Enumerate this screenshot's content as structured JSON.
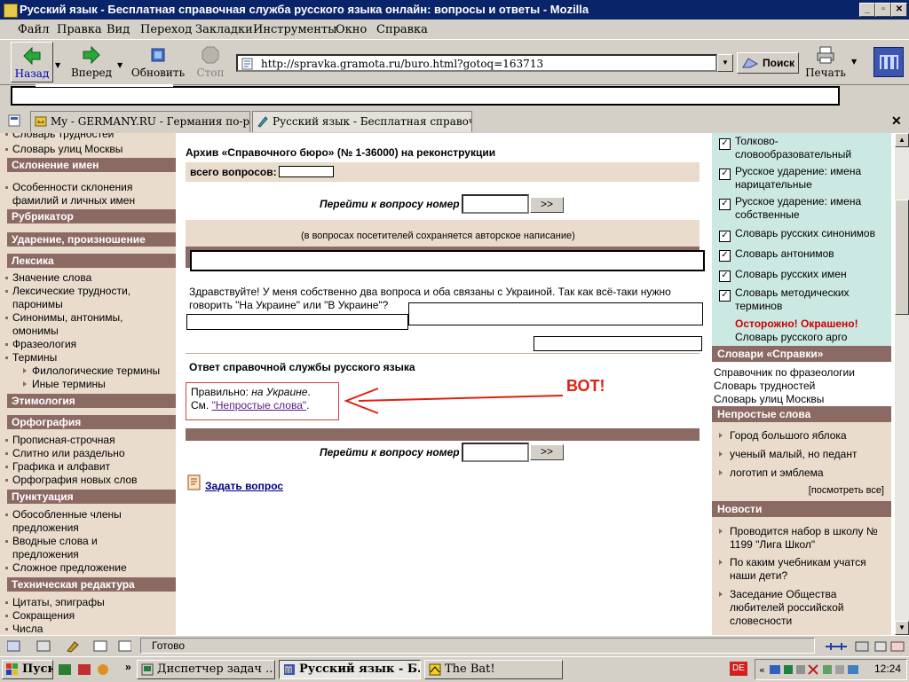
{
  "window": {
    "title": "Русский язык - Бесплатная справочная служба русского языка онлайн: вопросы и ответы - Mozilla",
    "buttons": [
      "_",
      "▫",
      "✕"
    ]
  },
  "menu": [
    "Файл",
    "Правка",
    "Вид",
    "Переход",
    "Закладки",
    "Инструменты",
    "Окно",
    "Справка"
  ],
  "nav": {
    "back": "Назад",
    "forward": "Вперед",
    "reload": "Обновить",
    "stop": "Стоп",
    "url": "http://spravka.gramota.ru/buro.html?gotoq=163713",
    "search": "Поиск",
    "print": "Печать"
  },
  "tabs": [
    {
      "label": "My - GERMANY.RU - Германия по-р...",
      "active": false
    },
    {
      "label": "Русский язык - Бесплатная справочн...",
      "active": true
    }
  ],
  "left_sidebar": {
    "items_top": [
      "Словарь трудностей",
      "Словарь улиц Москвы"
    ],
    "sections": [
      {
        "heading": "Склонение имен",
        "items": [
          "Особенности склонения фамилий и личных имен"
        ]
      },
      {
        "heading": "Рубрикатор",
        "items": []
      },
      {
        "heading": "Ударение, произношение",
        "items": []
      },
      {
        "heading": "Лексика",
        "items": [
          "Значение слова",
          "Лексические трудности, паронимы",
          "Синонимы, антонимы, омонимы",
          "Фразеология",
          "Термины"
        ],
        "subitems": [
          "Филологические термины",
          "Иные термины"
        ]
      },
      {
        "heading": "Этимология",
        "items": []
      },
      {
        "heading": "Орфография",
        "items": [
          "Прописная-строчная",
          "Слитно или раздельно",
          "Графика и алфавит",
          "Орфография новых слов"
        ]
      },
      {
        "heading": "Пунктуация",
        "items": [
          "Обособленные члены предложения",
          "Вводные слова и предложения",
          "Сложное предложение"
        ]
      },
      {
        "heading": "Техническая редактура",
        "items": [
          "Цитаты, эпиграфы",
          "Сокращения",
          "Числа"
        ]
      }
    ]
  },
  "main": {
    "archive_title": "Архив «Справочного бюро» (№ 1-36000) на реконструкции",
    "total_label": "всего вопросов:",
    "goto_label": "Перейти к вопросу номер",
    "go_button": ">>",
    "note": "(в вопросах посетителей сохраняется авторское написание)",
    "question": "Здравствуйте! У меня собственно два вопроса и оба связаны с Украиной. Так как всё-таки нужно говорить \"На Украине\" или \"В Украине\"?",
    "answer_heading": "Ответ справочной службы русского языка",
    "answer_prefix": "Правильно: ",
    "answer_value": "на Украине",
    "answer_suffix": ".",
    "see_prefix": "См. ",
    "see_link": "\"Непростые слова\"",
    "see_suffix": ".",
    "annotation": "ВОТ!",
    "ask_link": "Задать вопрос"
  },
  "right_sidebar": {
    "checked_dicts": [
      "Толково-словообразовательный",
      "Русское ударение: имена нарицательные",
      "Русское ударение: имена собственные",
      "Словарь русских синонимов",
      "Словарь антонимов",
      "Словарь русских имен",
      "Словарь методических терминов"
    ],
    "warning": "Осторожно! Окрашено!",
    "argo": "Словарь русского арго",
    "dicts_heading": "Словари «Справки»",
    "dicts_links": [
      "Справочник по фразеологии",
      "Словарь трудностей",
      "Словарь улиц Москвы"
    ],
    "hard_words_heading": "Непростые слова",
    "hard_words": [
      "Город большого яблока",
      "ученый малый, но педант",
      "логотип и эмблема"
    ],
    "see_all": "[посмотреть все]",
    "news_heading": "Новости",
    "news": [
      "Проводится набор в школу № 1199 \"Лига Школ\"",
      "По каким учебникам учатся наши дети?",
      "Заседание Общества любителей российской словесности"
    ]
  },
  "status": {
    "text": "Готово"
  },
  "taskbar": {
    "start": "Пуск",
    "items": [
      {
        "label": "Диспетчер задач ...",
        "pressed": false
      },
      {
        "label": "Русский язык - Б...",
        "pressed": true
      },
      {
        "label": "The Bat!",
        "pressed": false
      }
    ],
    "lang": "DE",
    "clock": "12:24"
  },
  "colors": {
    "accent": "#8c6a64",
    "sidebar_bg": "#eadccd",
    "title_bg": "#0a246a",
    "annotation": "#e02010",
    "warning": "#cc0000"
  }
}
